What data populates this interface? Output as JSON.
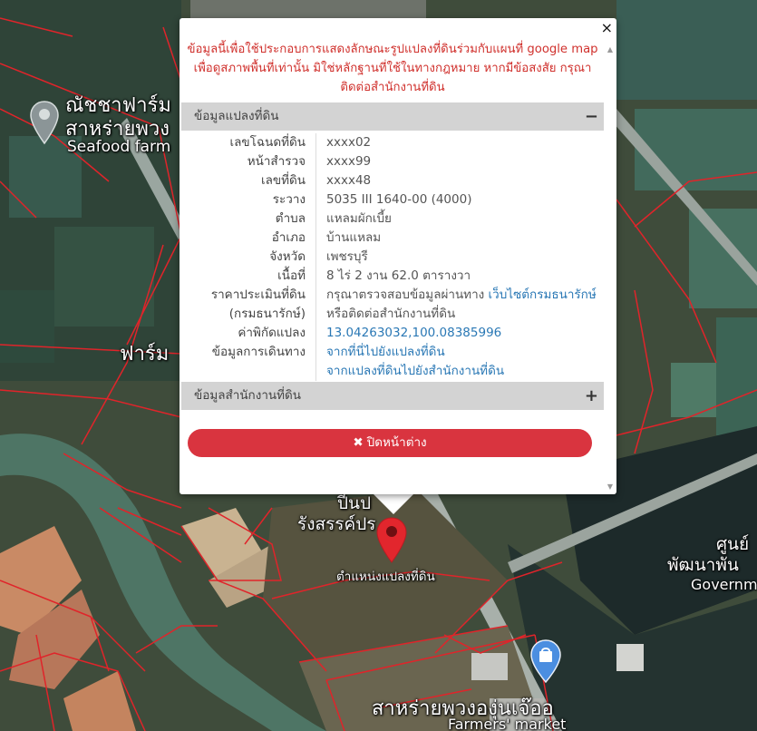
{
  "colors": {
    "danger": "#d0312d",
    "button": "#d9343f",
    "link": "#2a78b5",
    "section_header": "#d3d3d3",
    "parcel_line": "#e0242a"
  },
  "map": {
    "labels": {
      "farm_th_1": "ณัชชาฟาร์ม",
      "farm_th_2": "สาหร่ายพวง",
      "farm_en": "Seafood farm",
      "farm_th_3": "ฟาร์ม",
      "temple_th_1": "ปีนป",
      "temple_th_2": "รังสรรค์ปร",
      "center_th": "ศูนย์",
      "develop_th": "พัฒนาพัน",
      "gov_en": "Governm",
      "market_th": "สาหร่ายพวงองุ่นเจ๊ออ",
      "market_en": "Farmers' market",
      "marker_label": "ตำแหน่งแปลงที่ดิน"
    },
    "icons": {
      "farm_pin": "map-pin-icon",
      "marker": "location-marker-icon",
      "market_pin": "shopping-bag-pin-icon"
    }
  },
  "popup": {
    "close_symbol": "×",
    "disclaimer": {
      "line1": "ข้อมูลนี้เพื่อใช้ประกอบการแสดงลักษณะรูปแปลงที่ดินร่วมกับแผนที่ google map",
      "line2": "เพื่อดูสภาพพื้นที่เท่านั้น มิใช่หลักฐานที่ใช้ในทางกฎหมาย หากมีข้อสงสัย กรุณา",
      "line3": "ติดต่อสำนักงานที่ดิน"
    },
    "parcel_section": {
      "title": "ข้อมูลแปลงที่ดิน",
      "toggle": "−",
      "rows": {
        "deed_no": {
          "label": "เลขโฉนดที่ดิน",
          "value": "xxxx02"
        },
        "survey_page": {
          "label": "หน้าสำรวจ",
          "value": "xxxx99"
        },
        "land_no": {
          "label": "เลขที่ดิน",
          "value": "xxxx48"
        },
        "map_sheet": {
          "label": "ระวาง",
          "value": "5035 III 1640-00 (4000)"
        },
        "subdistrict": {
          "label": "ตำบล",
          "value": "แหลมผักเบี้ย"
        },
        "district": {
          "label": "อำเภอ",
          "value": "บ้านแหลม"
        },
        "province": {
          "label": "จังหวัด",
          "value": "เพชรบุรี"
        },
        "area": {
          "label": "เนื้อที่",
          "value": "8 ไร่ 2 งาน 62.0 ตารางวา"
        },
        "appraisal": {
          "label1": "ราคาประเมินที่ดิน",
          "label2": "(กรมธนารักษ์)",
          "value_text": "กรุณาตรวจสอบข้อมูลผ่านทาง ",
          "value_link": "เว็บไซต์กรมธนารักษ์",
          "value_line2": "หรือติดต่อสำนักงานที่ดิน"
        },
        "coords": {
          "label": "ค่าพิกัดแปลง",
          "value": "13.04263032,100.08385996"
        },
        "travel": {
          "label": "ข้อมูลการเดินทาง",
          "link1": "จากที่นี่ไปยังแปลงที่ดิน",
          "link2": "จากแปลงที่ดินไปยังสำนักงานที่ดิน"
        }
      }
    },
    "office_section": {
      "title": "ข้อมูลสำนักงานที่ดิน",
      "toggle": "+"
    },
    "close_button": {
      "icon": "✖",
      "label": "ปิดหน้าต่าง"
    }
  }
}
